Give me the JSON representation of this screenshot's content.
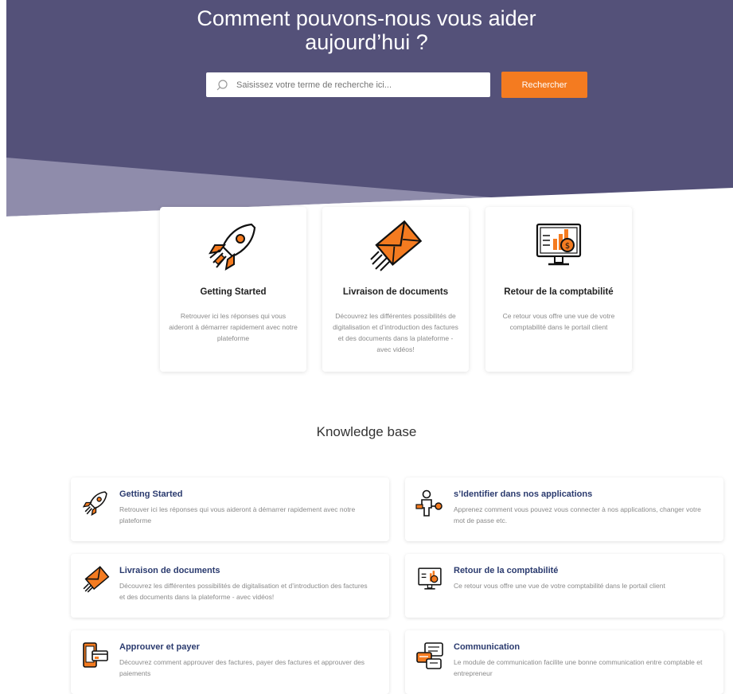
{
  "hero": {
    "title_line1": "Comment pouvons-nous vous aider",
    "title_line2": "aujourd’hui ?"
  },
  "search": {
    "placeholder": "Saisissez votre terme de recherche ici...",
    "button_label": "Rechercher"
  },
  "feature_cards": [
    {
      "icon": "rocket-icon",
      "title": "Getting Started",
      "description": "Retrouver ici les réponses qui vous aideront à démarrer rapidement avec notre plateforme"
    },
    {
      "icon": "envelope-icon",
      "title": "Livraison de documents",
      "description": "Découvrez les différentes possibilités de digitalisation et d’introduction des factures et des documents dans la plateforme - avec vidéos!"
    },
    {
      "icon": "accounting-monitor-icon",
      "title": "Retour de la comptabilité",
      "description": "Ce retour vous offre une vue de votre comptabilité dans le portail client"
    }
  ],
  "knowledge_base": {
    "title": "Knowledge base",
    "items": [
      {
        "icon": "rocket-icon",
        "title": "Getting Started",
        "description": "Retrouver ici les réponses qui vous aideront à démarrer rapidement avec notre plateforme"
      },
      {
        "icon": "user-key-icon",
        "title": "s’Identifier dans nos applications",
        "description": "Apprenez comment vous pouvez vous connecter à nos applications, changer votre mot de passe etc."
      },
      {
        "icon": "envelope-icon",
        "title": "Livraison de documents",
        "description": "Découvrez les différentes possibilités de digitalisation et d’introduction des factures et des documents dans la plateforme - avec vidéos!"
      },
      {
        "icon": "accounting-monitor-icon",
        "title": "Retour de la comptabilité",
        "description": "Ce retour vous offre une vue de votre comptabilité dans le portail client"
      },
      {
        "icon": "payment-phone-icon",
        "title": "Approuver et payer",
        "description": "Découvrez comment approuver des factures, payer des factures et approuver des paiements"
      },
      {
        "icon": "chat-bubbles-icon",
        "title": "Communication",
        "description": "Le module de communication facilite une bonne communication entre comptable et entrepreneur"
      }
    ]
  },
  "colors": {
    "hero_dark": "#545179",
    "hero_light": "#8f8cab",
    "accent": "#f47b20",
    "title_blue": "#2a3a6e"
  }
}
